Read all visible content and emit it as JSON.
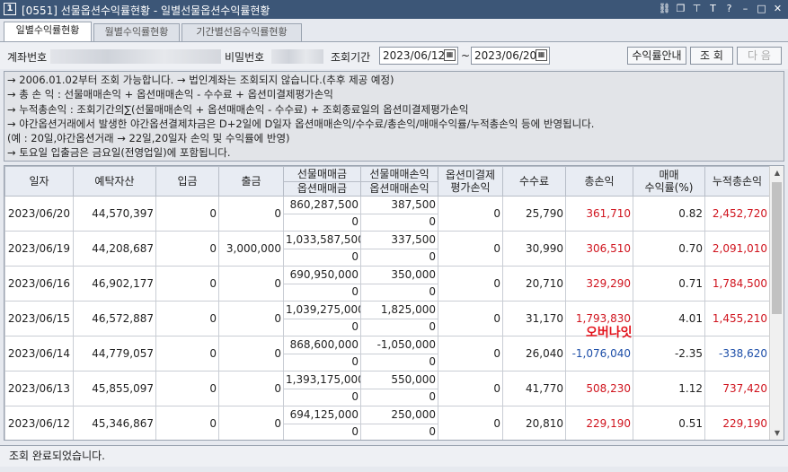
{
  "window": {
    "number": "1",
    "title": "[0551] 선물옵션수익률현황 - 일별선물옵션수익률현황",
    "icons": [
      "link-icon",
      "window-icon",
      "pin-icon",
      "font-icon",
      "help-icon",
      "minimize-icon",
      "restore-icon",
      "close-icon"
    ],
    "icon_glyphs": [
      "⛓",
      "❐",
      "⊤",
      "T",
      "?",
      "–",
      "□",
      "✕"
    ]
  },
  "tabs": [
    {
      "label": "일별수익률현황",
      "active": true
    },
    {
      "label": "월별수익률현황",
      "active": false
    },
    {
      "label": "기간별선옵수익률현황",
      "active": false
    }
  ],
  "toolbar": {
    "account_label": "계좌번호",
    "password_label": "비밀번호",
    "period_label": "조회기간",
    "start_date": "2023/06/12",
    "end_date": "2023/06/20",
    "tilde": "~",
    "guide_button": "수익률안내",
    "search_button": "조 회",
    "next_button": "다 음"
  },
  "notice": [
    "→ 2006.01.02부터 조회 가능합니다. → 법인계좌는 조회되지 않습니다.(추후 제공 예정)",
    "→ 총  손  익 : 선물매매손익 + 옵션매매손익 - 수수료 + 옵션미결제평가손익",
    "→ 누적총손익 : 조회기간의∑(선물매매손익 + 옵션매매손익 - 수수료) + 조회종료일의 옵션미결제평가손익",
    "→ 야간옵션거래에서 발생한 야간옵션결제차금은 D+2일에 D일자 옵션매매손익/수수료/총손익/매매수익률/누적총손익 등에 반영됩니다.",
    "    (예 : 20일,야간옵션거래  → 22일,20일자 손익 및 수익률에 반영)",
    "→ 토요일 입출금은 금요일(전영업일)에 포함됩니다."
  ],
  "grid": {
    "headers": {
      "date": "일자",
      "deposit_assets": "예탁자산",
      "deposit_in": "입금",
      "withdrawal": "출금",
      "fut_trade_amt": "선물매매금",
      "opt_trade_amt": "옵션매매금",
      "fut_trade_pl": "선물매매손익",
      "opt_trade_pl": "옵션매매손익",
      "opt_unsettled_top": "옵션미결제",
      "opt_unsettled_bottom": "평가손익",
      "fee": "수수료",
      "total_pl": "총손익",
      "return_top": "매매",
      "return_bottom": "수익률(%)",
      "cum_pl": "누적총손익"
    },
    "rows": [
      {
        "date": "2023/06/20",
        "assets": "44,570,397",
        "in": "0",
        "out": "0",
        "fut_amt": "860,287,500",
        "opt_amt": "0",
        "fut_pl": "387,500",
        "opt_pl": "0",
        "unsettled": "0",
        "fee": "25,790",
        "total": "361,710",
        "total_sign": "pos",
        "ret": "0.82",
        "cum": "2,452,720",
        "cum_sign": "pos"
      },
      {
        "date": "2023/06/19",
        "assets": "44,208,687",
        "in": "0",
        "out": "3,000,000",
        "fut_amt": "1,033,587,500",
        "opt_amt": "0",
        "fut_pl": "337,500",
        "opt_pl": "0",
        "unsettled": "0",
        "fee": "30,990",
        "total": "306,510",
        "total_sign": "pos",
        "ret": "0.70",
        "cum": "2,091,010",
        "cum_sign": "pos"
      },
      {
        "date": "2023/06/16",
        "assets": "46,902,177",
        "in": "0",
        "out": "0",
        "fut_amt": "690,950,000",
        "opt_amt": "0",
        "fut_pl": "350,000",
        "opt_pl": "0",
        "unsettled": "0",
        "fee": "20,710",
        "total": "329,290",
        "total_sign": "pos",
        "ret": "0.71",
        "cum": "1,784,500",
        "cum_sign": "pos"
      },
      {
        "date": "2023/06/15",
        "assets": "46,572,887",
        "in": "0",
        "out": "0",
        "fut_amt": "1,039,275,000",
        "opt_amt": "0",
        "fut_pl": "1,825,000",
        "opt_pl": "0",
        "unsettled": "0",
        "fee": "31,170",
        "total": "1,793,830",
        "total_sign": "pos",
        "ret": "4.01",
        "cum": "1,455,210",
        "cum_sign": "pos"
      },
      {
        "date": "2023/06/14",
        "assets": "44,779,057",
        "in": "0",
        "out": "0",
        "fut_amt": "868,600,000",
        "opt_amt": "0",
        "fut_pl": "-1,050,000",
        "opt_pl": "0",
        "unsettled": "0",
        "fee": "26,040",
        "total": "-1,076,040",
        "total_sign": "neg",
        "ret": "-2.35",
        "cum": "-338,620",
        "cum_sign": "neg"
      },
      {
        "date": "2023/06/13",
        "assets": "45,855,097",
        "in": "0",
        "out": "0",
        "fut_amt": "1,393,175,000",
        "opt_amt": "0",
        "fut_pl": "550,000",
        "opt_pl": "0",
        "unsettled": "0",
        "fee": "41,770",
        "total": "508,230",
        "total_sign": "pos",
        "ret": "1.12",
        "cum": "737,420",
        "cum_sign": "pos"
      },
      {
        "date": "2023/06/12",
        "assets": "45,346,867",
        "in": "0",
        "out": "0",
        "fut_amt": "694,125,000",
        "opt_amt": "0",
        "fut_pl": "250,000",
        "opt_pl": "0",
        "unsettled": "0",
        "fee": "20,810",
        "total": "229,190",
        "total_sign": "pos",
        "ret": "0.51",
        "cum": "229,190",
        "cum_sign": "pos"
      }
    ]
  },
  "overlay_text": "오버나잇",
  "status": "조회 완료되었습니다.",
  "colors": {
    "positive": "#d0141e",
    "negative": "#1d4ea8",
    "titlebar": "#3c5677"
  }
}
